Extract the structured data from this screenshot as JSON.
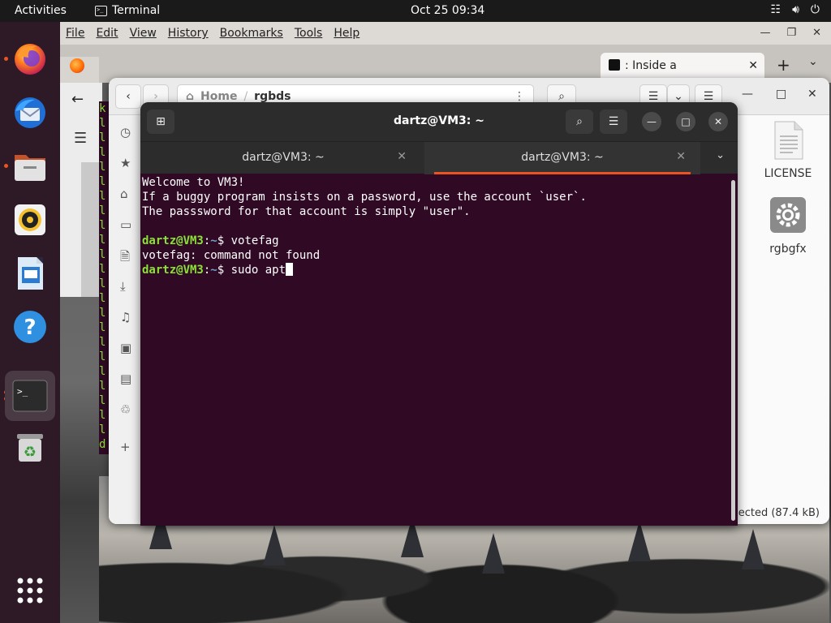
{
  "topbar": {
    "activities": "Activities",
    "app_name": "Terminal",
    "clock": "Oct 25  09:34"
  },
  "firefox": {
    "menu": [
      "File",
      "Edit",
      "View",
      "History",
      "Bookmarks",
      "Tools",
      "Help"
    ],
    "active_tab": ": Inside a",
    "new_tab": "+",
    "tab_list": "⌄"
  },
  "nautilus": {
    "path_home": "Home",
    "path_current": "rgbds",
    "files": [
      {
        "name": "LICENSE",
        "icon": "text-file-icon"
      },
      {
        "name": "rgbgfx",
        "icon": "executable-gear-icon"
      }
    ],
    "status": "ected  (87.4 kB)"
  },
  "terminal": {
    "title": "dartz@VM3: ~",
    "tabs": [
      {
        "label": "dartz@VM3: ~",
        "active": false
      },
      {
        "label": "dartz@VM3: ~",
        "active": true
      }
    ],
    "lines": {
      "l1": "Welcome to VM3!",
      "l2": "If a buggy program insists on a password, use the account `user`.",
      "l3": "The passsword for that account is simply \"user\".",
      "p1_user": "dartz@VM3",
      "p1_path": "~",
      "p1_cmd": " votefag",
      "out1": "votefag: command not found",
      "p2_user": "dartz@VM3",
      "p2_path": "~",
      "p2_cmd": " sudo apt"
    }
  },
  "colors": {
    "terminal_bg": "#300a24",
    "prompt_user": "#8ae234",
    "prompt_path": "#729fcf",
    "accent": "#e95420"
  }
}
